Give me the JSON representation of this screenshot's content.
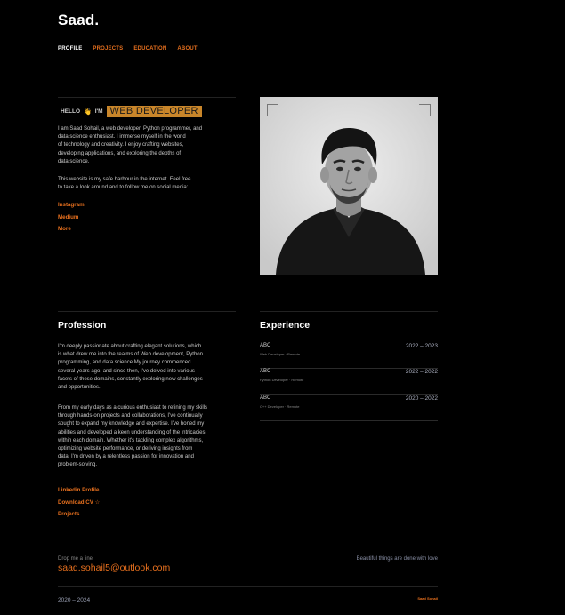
{
  "header": {
    "logo": "Saad."
  },
  "nav": [
    {
      "label": "PROFILE"
    },
    {
      "label": "PROJECTS"
    },
    {
      "label": "EDUCATION"
    },
    {
      "label": "ABOUT"
    }
  ],
  "hero": {
    "hello": "HELLO",
    "wave": "👋",
    "im": "I'M",
    "role": "WEB DEVELOPER",
    "intro_lines": [
      "I am Saad Sohail, a web developer, Python programmer, and",
      "data science enthusiast. I immerse myself in the world",
      "of technology and creativity. I enjoy crafting websites,",
      "developing applications, and exploring the depths of",
      "data science."
    ],
    "harbour_lines": [
      "This website is my safe harbour in the internet. Feel free",
      "to take a look around and to follow me on social media:"
    ],
    "links": [
      "Instagram",
      "Medium",
      "More"
    ]
  },
  "profession": {
    "heading": "Profession",
    "para1_lines": [
      "I'm deeply passionate about crafting elegant solutions, which",
      "is what drew me into the realms of Web development, Python",
      "programming, and data science.My journey commenced",
      "several years ago, and since then, I've delved into various",
      "facets of these domains, constantly exploring new challenges",
      "and opportunities."
    ],
    "para2_lines": [
      "From my early days as a curious enthusiast to refining my skills",
      "through hands-on projects and collaborations, I've continually",
      "sought to expand my knowledge and expertise. I've honed my",
      "abilities and developed a keen understanding of the intricacies",
      "within each domain. Whether it's tackling complex algorithms,",
      "optimizing website performance, or deriving insights from",
      "data, I'm driven by a relentless passion for innovation and",
      "problem-solving."
    ],
    "links": [
      "Linkedin Profile",
      "Download CV ☆",
      "Projects"
    ]
  },
  "experience": {
    "heading": "Experience",
    "items": [
      {
        "company": "ABC",
        "role": "Web Developer · Remote",
        "years": "2022 – 2023"
      },
      {
        "company": "ABC",
        "role": "Python Developer · Remote",
        "years": "2022 – 2022"
      },
      {
        "company": "ABC",
        "role": "C++ Developer · Remote",
        "years": "2020 – 2022"
      }
    ]
  },
  "footer": {
    "label": "Drop me a line",
    "email": "saad.sohail5@outlook.com",
    "tagline": "Beautiful things are done with love",
    "years": "2020 – 2024",
    "name": "Saad Sohail"
  },
  "colors": {
    "accent": "#e7701e",
    "role_bg": "#c9862a",
    "background": "#000000"
  }
}
